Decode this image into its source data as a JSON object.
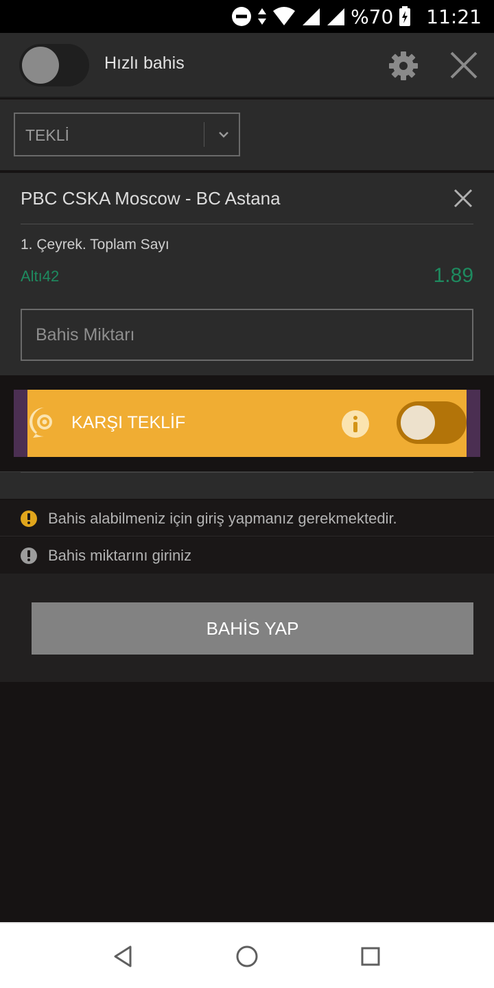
{
  "status_bar": {
    "battery": "%70",
    "time": "11:21",
    "icons": [
      "do-not-disturb-icon",
      "data-arrows-icon",
      "wifi-icon",
      "signal-icon",
      "signal-icon",
      "battery-charging-icon"
    ]
  },
  "header": {
    "quick_bet_label": "Hızlı bahis",
    "quick_bet_enabled": false,
    "icons": [
      "settings-gear-icon",
      "close-icon"
    ]
  },
  "bet_type": {
    "selected": "TEKLİ"
  },
  "event": {
    "title": "PBC CSKA Moscow - BC Astana",
    "market": "1. Çeyrek. Toplam Sayı",
    "selection": "Altı42",
    "odds": "1.89",
    "stake_placeholder": "Bahis Miktarı"
  },
  "counter_offer": {
    "label": "KARŞI TEKLİF",
    "enabled": false
  },
  "warnings": [
    {
      "text": "Bahis alabilmeniz için giriş yapmanız gerekmektedir.",
      "color": "#e0a51c"
    },
    {
      "text": "Bahis miktarını giriniz",
      "color": "#9c9c9c"
    }
  ],
  "submit": {
    "label": "BAHİS YAP"
  },
  "nav_bar": {
    "icons": [
      "back-triangle-icon",
      "home-circle-icon",
      "recents-square-icon"
    ]
  },
  "colors": {
    "odds_green": "#1e8a5f",
    "offer_orange": "#f0ad33",
    "offer_edge_purple": "#4b2f52",
    "panel": "#2b2b2b"
  }
}
